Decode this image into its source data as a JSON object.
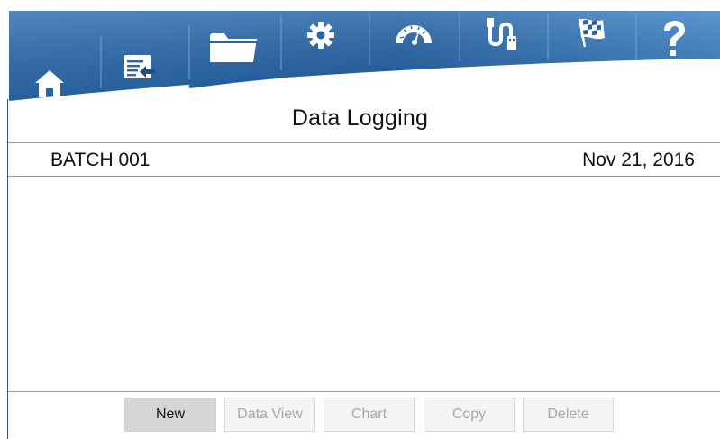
{
  "screen": {
    "title": "Data Logging"
  },
  "nav": {
    "tabs": [
      {
        "icon": "home-icon"
      },
      {
        "icon": "import-icon"
      },
      {
        "icon": "folder-icon",
        "selected": true
      },
      {
        "icon": "gear-icon"
      },
      {
        "icon": "gauge-icon"
      },
      {
        "icon": "usb-icon"
      },
      {
        "icon": "checkered-flag-icon"
      },
      {
        "icon": "help-icon"
      }
    ]
  },
  "list": {
    "items": [
      {
        "name": "BATCH 001",
        "date": "Nov 21, 2016"
      }
    ]
  },
  "toolbar": {
    "new_label": "New",
    "data_view_label": "Data View",
    "chart_label": "Chart",
    "copy_label": "Copy",
    "delete_label": "Delete"
  },
  "colors": {
    "nav_band": "#1f5fa3",
    "nav_band_light": "#5a95d0",
    "tab_underline": "#1f5fa3",
    "button_primary_bg": "#d6d6d6",
    "button_disabled_bg": "#f4f4f4",
    "button_disabled_text": "#a8a8a8"
  }
}
